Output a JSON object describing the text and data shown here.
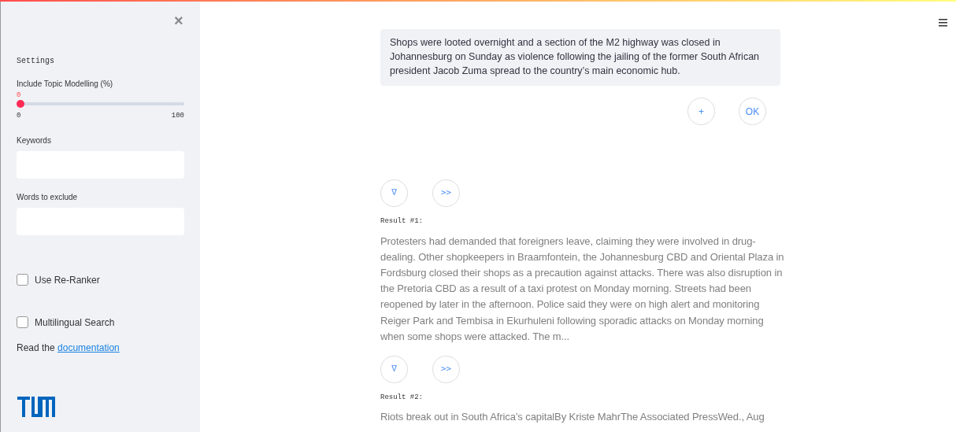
{
  "sidebar": {
    "close_glyph": "×",
    "heading": "Settings",
    "slider": {
      "label": "Include Topic Modelling (%)",
      "value": "0",
      "level": 0,
      "min": "0",
      "max": "100"
    },
    "fields": [
      {
        "label": "Keywords"
      },
      {
        "label": "Words to exclude"
      }
    ],
    "checkboxes": [
      {
        "label": "Use Re-Ranker",
        "checked": false
      },
      {
        "label": "Multilingual Search",
        "checked": false
      }
    ],
    "docs": {
      "text": "Read the ",
      "link": "documentation"
    }
  },
  "query": {
    "value": "Shops were looted overnight and a section of the M2 highway was closed in Johannesburg on Sunday as violence following the jailing of the former South African president Jacob Zuma spread to the country’s main economic hub.",
    "buttons": [
      "+",
      "OK"
    ]
  },
  "results": [
    {
      "buttons": [
        "∇",
        ">>"
      ],
      "label": "Result #1:",
      "text": "Protesters had demanded that foreigners leave, claiming they were involved in drug-dealing. Other shopkeepers in Braamfontein, the Johannesburg CBD and Oriental Plaza in Fordsburg closed their shops as a precaution against attacks. There was also disruption in the Pretoria CBD as a result of a taxi protest on Monday morning. Streets had been reopened by later in the afternoon. Police said they were on high alert and monitoring Reiger Park and Tembisa in Ekurhuleni following sporadic attacks on Monday morning when some shops were attacked. The m..."
    },
    {
      "buttons": [
        "∇",
        ">>"
      ],
      "label": "Result #2:",
      "text": "Riots break out in South Africa’s capitalBy Kriste MahrThe Associated PressWed., Aug"
    }
  ]
}
